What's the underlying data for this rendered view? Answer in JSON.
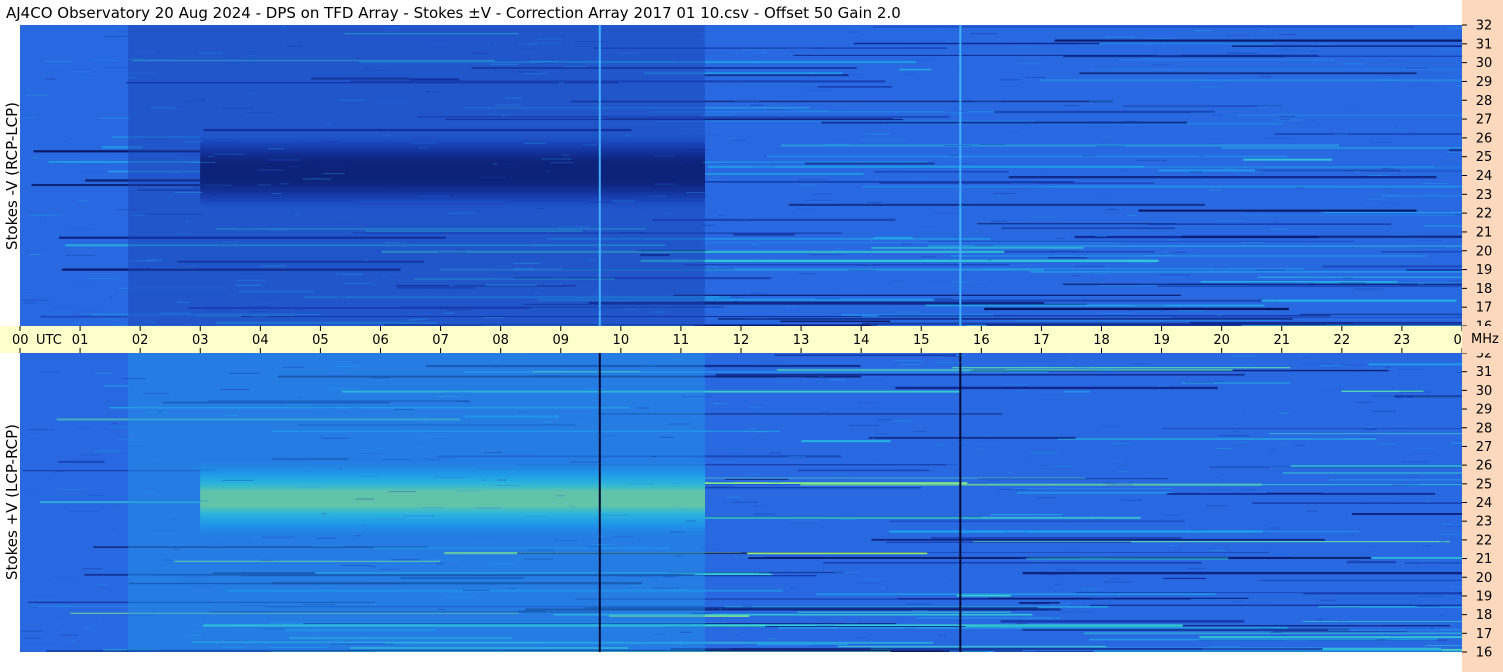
{
  "header": {
    "title": "AJ4CO Observatory  20 Aug 2024  -  DPS on TFD Array  -  Stokes ±V  -  Correction Array 2017 01 10.csv  -  Offset 50  Gain 2.0"
  },
  "chart_data": {
    "type": "heatmap",
    "title": "AJ4CO Observatory  20 Aug 2024  -  DPS on TFD Array  -  Stokes ±V  -  Correction Array 2017 01 10.csv  -  Offset 50  Gain 2.0",
    "xlabel": "UTC",
    "ylabel_unit": "MHz",
    "x_ticks": [
      "00",
      "01",
      "02",
      "03",
      "04",
      "05",
      "06",
      "07",
      "08",
      "09",
      "10",
      "11",
      "12",
      "13",
      "14",
      "15",
      "16",
      "17",
      "18",
      "19",
      "20",
      "21",
      "22",
      "23",
      "00"
    ],
    "xlim_hours": [
      0,
      24
    ],
    "y_ticks": [
      16,
      17,
      18,
      19,
      20,
      21,
      22,
      23,
      24,
      25,
      26,
      27,
      28,
      29,
      30,
      31,
      32
    ],
    "ylim_mhz": [
      16,
      32
    ],
    "panels": [
      {
        "name": "Stokes -V (RCP-LCP)",
        "polarity": -1,
        "base_color": "#2f6be6",
        "features": {
          "dark_band": {
            "t_start": 3.0,
            "t_end": 11.4,
            "f_center": 24.2,
            "f_width": 1.6,
            "peak": 0.6
          },
          "vertical_lines_hours": [
            9.65,
            15.65
          ]
        }
      },
      {
        "name": "Stokes +V (LCP-RCP)",
        "polarity": 1,
        "base_color": "#2f6be6",
        "features": {
          "bright_band": {
            "t_start": 3.0,
            "t_end": 11.4,
            "f_center": 24.2,
            "f_width": 1.6,
            "peak": 0.6
          },
          "vertical_lines_hours": [
            9.65,
            15.65
          ]
        }
      }
    ]
  }
}
